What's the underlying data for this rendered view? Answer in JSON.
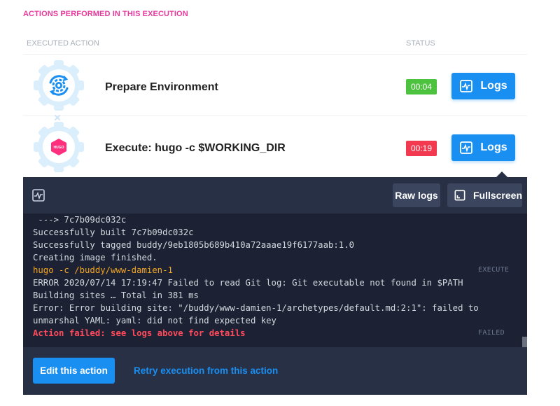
{
  "section_title": "ACTIONS PERFORMED IN THIS EXECUTION",
  "columns": {
    "action": "EXECUTED ACTION",
    "status": "STATUS"
  },
  "actions": [
    {
      "icon": "environment-gear-icon",
      "name": "Prepare Environment",
      "duration": "00:04",
      "status_color": "#4cc23f",
      "logs_label": "Logs"
    },
    {
      "icon": "hugo-logo-icon",
      "logo_text": "HUGO",
      "name": "Execute: hugo -c $WORKING_DIR",
      "duration": "00:19",
      "status_color": "#f3394f",
      "logs_label": "Logs"
    }
  ],
  "log_panel": {
    "raw_logs_label": "Raw logs",
    "fullscreen_label": "Fullscreen",
    "lines": [
      " ---> 7c7b09dc032c",
      "Successfully built 7c7b09dc032c",
      "Successfully tagged buddy/9eb1805b689b410a72aaae19f6177aab:1.0",
      "Creating image finished.",
      "hugo -c /buddy/www-damien-1",
      "ERROR 2020/07/14 17:19:47 Failed to read Git log: Git executable not found in $PATH",
      "Building sites … Total in 381 ms",
      "Error: Error building site: \"/buddy/www-damien-1/archetypes/default.md:2:1\": failed to",
      "unmarshal YAML: yaml: did not find expected key",
      "Action failed: see logs above for details"
    ],
    "execute_tag": "EXECUTE",
    "failed_tag": "FAILED",
    "edit_label": "Edit this action",
    "retry_label": "Retry execution from this action"
  },
  "colors": {
    "accent": "#1a8ff2",
    "section_title": "#e6399b",
    "success": "#4cc23f",
    "failure": "#f3394f",
    "panel_bg": "#283045",
    "console_bg": "#1c2233",
    "command_text": "#f5a623"
  }
}
